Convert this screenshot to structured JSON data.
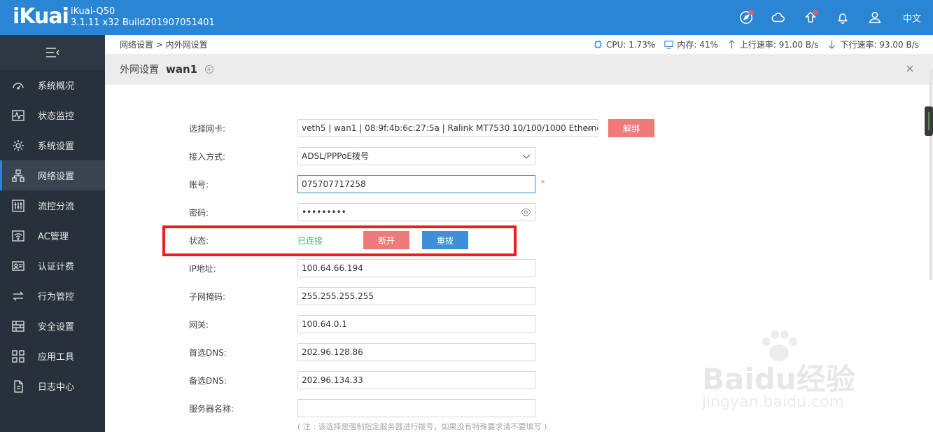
{
  "header": {
    "logo": "iKuai",
    "model": "iKuai-Q50",
    "build": "3.1.11 x32 Build201907051401",
    "language": "中文"
  },
  "sidebar": {
    "items": [
      {
        "label": "系统概况",
        "icon": "dashboard-icon"
      },
      {
        "label": "状态监控",
        "icon": "pulse-icon"
      },
      {
        "label": "系统设置",
        "icon": "gear-icon"
      },
      {
        "label": "网络设置",
        "icon": "network-icon",
        "active": true
      },
      {
        "label": "流控分流",
        "icon": "sliders-icon"
      },
      {
        "label": "AC管理",
        "icon": "wifi-icon"
      },
      {
        "label": "认证计费",
        "icon": "id-card-icon"
      },
      {
        "label": "行为管控",
        "icon": "swap-icon"
      },
      {
        "label": "安全设置",
        "icon": "firewall-icon"
      },
      {
        "label": "应用工具",
        "icon": "apps-icon"
      },
      {
        "label": "日志中心",
        "icon": "log-icon"
      }
    ]
  },
  "breadcrumb": "网络设置 > 内外网设置",
  "stats": {
    "cpu": "CPU: 1.73%",
    "memory": "内存: 41%",
    "upload": "上行速率: 91.00 B/s",
    "download": "下行速率: 93.00 B/s"
  },
  "tab": {
    "title": "外网设置",
    "name": "wan1"
  },
  "form": {
    "nic_label": "选择网卡:",
    "nic_value": "veth5 | wan1 | 08:9f:4b:6c:27:5a | Ralink MT7530 10/100/1000 Etherne",
    "unbind_label": "解绑",
    "access_label": "接入方式:",
    "access_value": "ADSL/PPPoE拨号",
    "account_label": "账号:",
    "account_value": "075707717258",
    "required_mark": "*",
    "password_label": "密码:",
    "password_value": "•••••••••",
    "status_label": "状态:",
    "status_value": "已连接",
    "disconnect_label": "断开",
    "redial_label": "重拨",
    "ip_label": "IP地址:",
    "ip_value": "100.64.66.194",
    "mask_label": "子网掩码:",
    "mask_value": "255.255.255.255",
    "gateway_label": "网关:",
    "gateway_value": "100.64.0.1",
    "dns1_label": "首选DNS:",
    "dns1_value": "202.96.128.86",
    "dns2_label": "备选DNS:",
    "dns2_value": "202.96.134.33",
    "server_label": "服务器名称:",
    "server_value": "",
    "note": "( 注 : 该选择是强制指定服务器进行拨号，如果没有特殊要求请不要填写 )"
  },
  "watermark": {
    "brand": "Baidu经验",
    "url": "jingyan.baidu.com"
  },
  "colors": {
    "topbar": "#2a86d4",
    "sidebar": "#28303b",
    "danger_button": "#f07a7a",
    "primary_button": "#3f8ed8",
    "connected": "#3bb56b",
    "highlight": "#ef1d1d"
  }
}
